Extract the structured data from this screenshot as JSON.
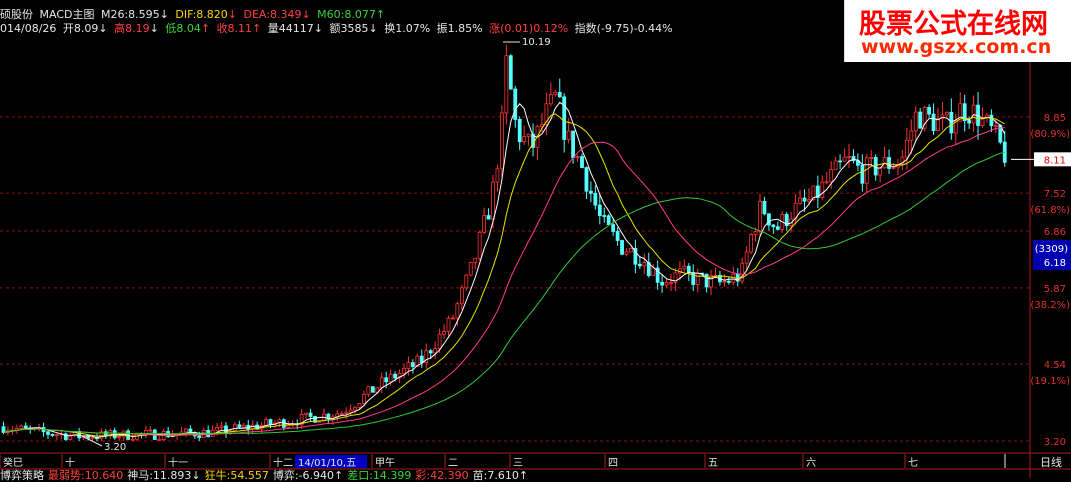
{
  "header": {
    "stock": "硕股份",
    "indicator": "MACD主图",
    "m26": "M26:8.595",
    "m26_arrow": "↓",
    "dif": "DIF:8.820",
    "dif_arrow": "↓",
    "dea": "DEA:8.349",
    "dea_arrow": "↓",
    "m60": "M60:8.077",
    "m60_arrow": "↑"
  },
  "quote": {
    "date": "014/08/26",
    "open": "开8.09",
    "open_arrow": "↓",
    "high": "高8.19",
    "high_arrow": "↓",
    "low": "低8.04",
    "low_arrow": "↑",
    "close": "收8.11",
    "close_arrow": "↑",
    "volume": "量44117",
    "volume_arrow": "↓",
    "amount": "额3585",
    "amount_arrow": "↓",
    "turnover": "换1.07%",
    "amplitude": "振1.85%",
    "change": "涨(0.01)0.12%",
    "index": "指数(-9.75)-0.44%"
  },
  "watermark": {
    "line1": "股票公式在线网",
    "line2": "www.gszx.com.cn"
  },
  "price_axis": [
    {
      "label": "8.85",
      "pct": "(80.9%)",
      "price": 8.85
    },
    {
      "label": "7.52",
      "pct": "(61.8%)",
      "price": 7.52
    },
    {
      "label": "6.86",
      "pct": "",
      "price": 6.86
    },
    {
      "label": "5.87",
      "pct": "(38.2%)",
      "price": 5.87
    },
    {
      "label": "4.54",
      "pct": "(19.1%)",
      "price": 4.54
    },
    {
      "label": "3.20",
      "pct": "",
      "price": 3.2
    }
  ],
  "current_price": "8.11",
  "cursor_box": {
    "line1": "(3309)",
    "line2": "6.18"
  },
  "annotations": {
    "high": "10.19",
    "low": "3.20"
  },
  "time_axis": [
    {
      "label": "癸巳"
    },
    {
      "label": "十"
    },
    {
      "label": "十一"
    },
    {
      "label": "十二"
    },
    {
      "label": "14/01/10,五",
      "highlight": true
    },
    {
      "label": "甲午"
    },
    {
      "label": "二"
    },
    {
      "label": "三"
    },
    {
      "label": "四"
    },
    {
      "label": "五"
    },
    {
      "label": "六"
    },
    {
      "label": "七"
    }
  ],
  "period_button": "日线",
  "bottom_bar": [
    {
      "text": "博弈策略",
      "color": "#e6e6e6"
    },
    {
      "text": "最弱势:10.640",
      "color": "#ff4040"
    },
    {
      "text": "神马:11.893↓",
      "color": "#e6e6e6"
    },
    {
      "text": "狂牛:54.557",
      "color": "#ffd400"
    },
    {
      "text": "博弈:-6.940↑",
      "color": "#e6e6e6"
    },
    {
      "text": "差口:14.399",
      "color": "#3cd23c"
    },
    {
      "text": "彩:42.390",
      "color": "#ff4040"
    },
    {
      "text": "苗:7.610↑",
      "color": "#e6e6e6"
    }
  ],
  "colors": {
    "up": "#ff3232",
    "down": "#54ffff",
    "ma_white": "#ffffff",
    "ma_yellow": "#e6e600",
    "ma_magenta": "#ff3c8c",
    "ma_green": "#32c832",
    "grid": "#8a1010"
  },
  "chart_data": {
    "type": "candlestick",
    "y_range": [
      3.2,
      10.19
    ],
    "annotations": {
      "high": 10.19,
      "low": 3.2
    },
    "last_close": 8.11
  }
}
